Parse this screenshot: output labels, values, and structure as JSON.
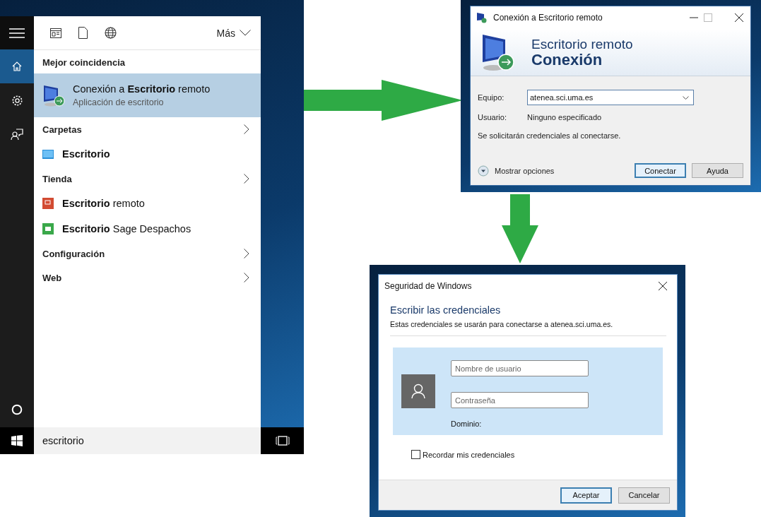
{
  "search_panel": {
    "rail": [
      {
        "kind": "home",
        "selected": true
      },
      {
        "kind": "settings",
        "selected": false
      },
      {
        "kind": "feedback",
        "selected": false
      }
    ],
    "more": "Más",
    "best_match_heading": "Mejor coincidencia",
    "best_match": {
      "title": "Conexión a **Escritorio** remoto",
      "subtitle": "Aplicación de escritorio",
      "selected": true
    },
    "sections": [
      {
        "heading": "Carpetas",
        "items": [
          {
            "kind": "folder",
            "match": "Escritorio"
          }
        ]
      },
      {
        "heading": "Tienda",
        "items": [
          {
            "kind": "remote",
            "match": "Escritorio",
            "rest": " remoto"
          },
          {
            "kind": "sage",
            "match": "Escritorio",
            "rest": " Sage Despachos"
          }
        ]
      },
      {
        "heading": "Configuración"
      },
      {
        "heading": "Web"
      }
    ],
    "search_box": {
      "value": "escritorio"
    }
  },
  "remote_window": {
    "title": "Conexión a Escritorio remoto",
    "header_line1": "Escritorio remoto",
    "header_line2": "Conexión",
    "computer": {
      "label": "Equipo:",
      "value": "atenea.sci.uma.es"
    },
    "user": {
      "label": "Usuario:",
      "value": "Ninguno especificado"
    },
    "note": "Se solicitarán credenciales al conectarse.",
    "options": "Mostrar opciones",
    "buttons": [
      {
        "label": "Conectar",
        "default": true
      },
      {
        "label": "Ayuda",
        "default": false
      }
    ]
  },
  "security_dialog": {
    "title": "Seguridad de Windows",
    "heading": "Escribir las credenciales",
    "description": "Estas credenciales se usarán para conectarse a atenea.sci.uma.es.",
    "username": {
      "placeholder": "Nombre de usuario"
    },
    "password": {
      "placeholder": "Contraseña"
    },
    "domain": "Dominio:",
    "remember": {
      "label": "Recordar mis credenciales",
      "checked": false
    },
    "buttons": [
      {
        "label": "Aceptar",
        "default": true
      },
      {
        "label": "Cancelar",
        "default": false
      }
    ]
  }
}
